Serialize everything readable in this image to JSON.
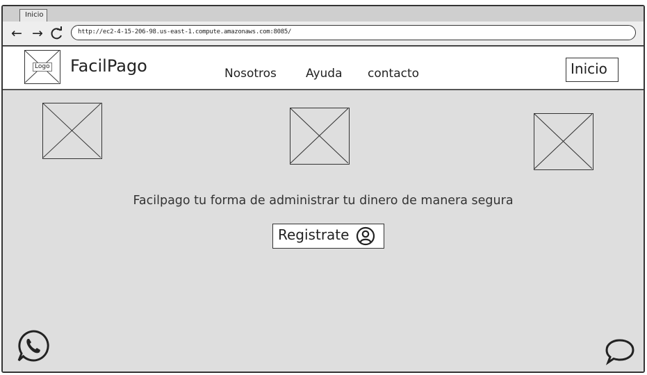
{
  "browser": {
    "tab_title": "Inicio",
    "url": "http://ec2-4-15-206-98.us-east-1.compute.amazonaws.com:8085/"
  },
  "header": {
    "logo_label": "Logo",
    "brand": "FacilPago",
    "nav": [
      "Nosotros",
      "Ayuda",
      "contacto"
    ],
    "inicio_label": "Inicio"
  },
  "main": {
    "tagline": "Facilpago tu forma de administrar tu dinero de manera segura",
    "register_label": "Registrate"
  },
  "icons": {
    "back": "arrow-left-icon",
    "forward": "arrow-right-icon",
    "reload": "reload-icon",
    "user": "user-circle-icon",
    "whatsapp": "whatsapp-icon",
    "chat": "chat-bubble-icon"
  }
}
